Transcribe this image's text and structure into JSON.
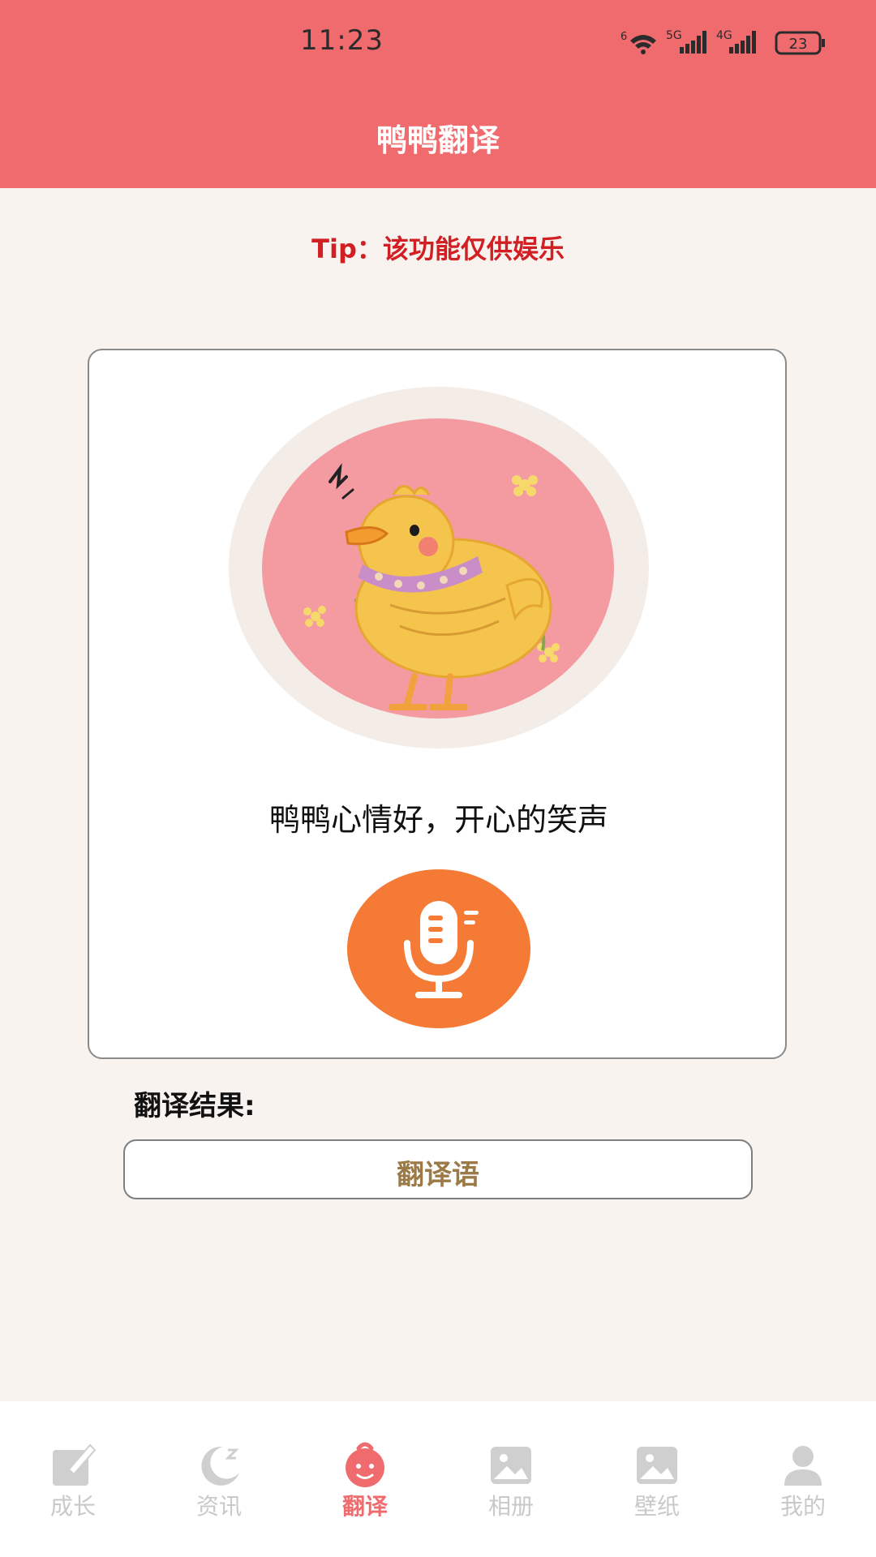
{
  "status_bar": {
    "time": "11:23",
    "network_left": "5G",
    "network_right": "4G",
    "wifi_label": "6",
    "battery": "23"
  },
  "header": {
    "title": "鸭鸭翻译"
  },
  "tip": {
    "text": "Tip：该功能仅供娱乐"
  },
  "main": {
    "mood_text": "鸭鸭心情好，开心的笑声",
    "result_label": "翻译结果:",
    "result_placeholder": "翻译语"
  },
  "bottom_nav": {
    "items": [
      {
        "label": "成长",
        "icon": "edit-icon",
        "active": false
      },
      {
        "label": "资讯",
        "icon": "moon-icon",
        "active": false
      },
      {
        "label": "翻译",
        "icon": "baby-face-icon",
        "active": true
      },
      {
        "label": "相册",
        "icon": "image-icon",
        "active": false
      },
      {
        "label": "壁纸",
        "icon": "image-icon",
        "active": false
      },
      {
        "label": "我的",
        "icon": "user-icon",
        "active": false
      }
    ]
  },
  "colors": {
    "header_bg": "#ef6b6e",
    "page_bg": "#f8f3ef",
    "mic_button": "#f57a35",
    "tip_text": "#d21f23",
    "result_text": "#9b7a47",
    "nav_inactive": "#c9c9c9"
  }
}
